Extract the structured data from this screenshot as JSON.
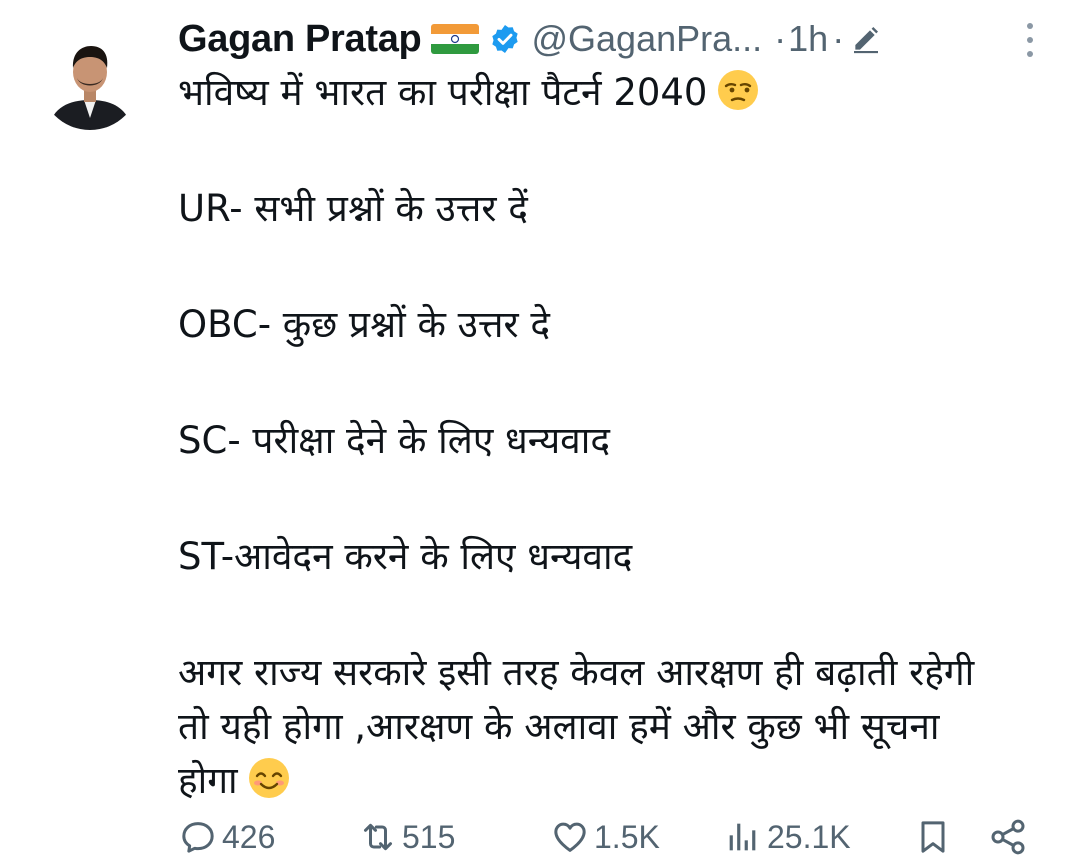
{
  "author": {
    "display_name": "Gagan Pratap",
    "flag_icon": "india-flag-icon",
    "verified_icon": "verified-badge-icon",
    "verified_color": "#1d9bf0",
    "handle": "@GaganPra...",
    "separator": "·",
    "time": "1h",
    "separator2": "·"
  },
  "tweet": {
    "lines": [
      "भविष्य में भारत का परीक्षा पैटर्न 2040",
      "UR- सभी प्रश्नों के उत्तर दें",
      "OBC- कुछ प्रश्नों के उत्तर दे",
      "SC- परीक्षा देने के लिए धन्यवाद",
      "ST-आवेदन करने के लिए धन्यवाद",
      "अगर राज्य सरकारे इसी तरह केवल आरक्षण ही बढ़ाती रहेगी",
      "तो यही होगा ,आरक्षण के अलावा हमें और कुछ भी सूचना",
      "होगा"
    ],
    "emoji_1": "unamused-face-emoji",
    "emoji_2": "smiling-face-emoji"
  },
  "actions": {
    "reply_count": "426",
    "retweet_count": "515",
    "like_count": "1.5K",
    "views_count": "25.1K"
  },
  "colors": {
    "text": "#0f1419",
    "secondary": "#536471",
    "background": "#ffffff"
  }
}
